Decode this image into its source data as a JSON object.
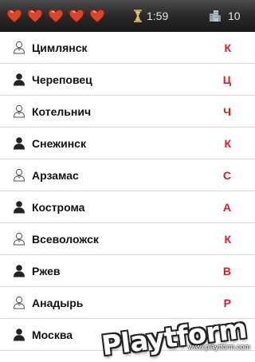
{
  "status_bar": {
    "hearts_count": 5,
    "heart_color": "#d7462b",
    "timer_icon": "hourglass-icon",
    "timer_value": "1:59",
    "score_icon": "buildings-icon",
    "score_value": "10"
  },
  "cities": [
    {
      "name": "Цимлянск",
      "letter": "К",
      "icon": "person-outline-icon"
    },
    {
      "name": "Череповец",
      "letter": "Ц",
      "icon": "person-filled-icon"
    },
    {
      "name": "Котельнич",
      "letter": "Ч",
      "icon": "person-outline-icon"
    },
    {
      "name": "Снежинск",
      "letter": "К",
      "icon": "person-filled-icon"
    },
    {
      "name": "Арзамас",
      "letter": "С",
      "icon": "person-outline-icon"
    },
    {
      "name": "Кострома",
      "letter": "А",
      "icon": "person-filled-icon"
    },
    {
      "name": "Всеволожск",
      "letter": "К",
      "icon": "person-outline-icon"
    },
    {
      "name": "Ржев",
      "letter": "В",
      "icon": "person-filled-icon"
    },
    {
      "name": "Анадырь",
      "letter": "Р",
      "icon": "person-outline-icon"
    },
    {
      "name": "Москва",
      "letter": "",
      "icon": "person-filled-icon"
    }
  ],
  "colors": {
    "letter": "#d0202a",
    "topbar": "#262626"
  },
  "watermark": {
    "brand": "Playtform",
    "url": "www.playtform.com"
  }
}
